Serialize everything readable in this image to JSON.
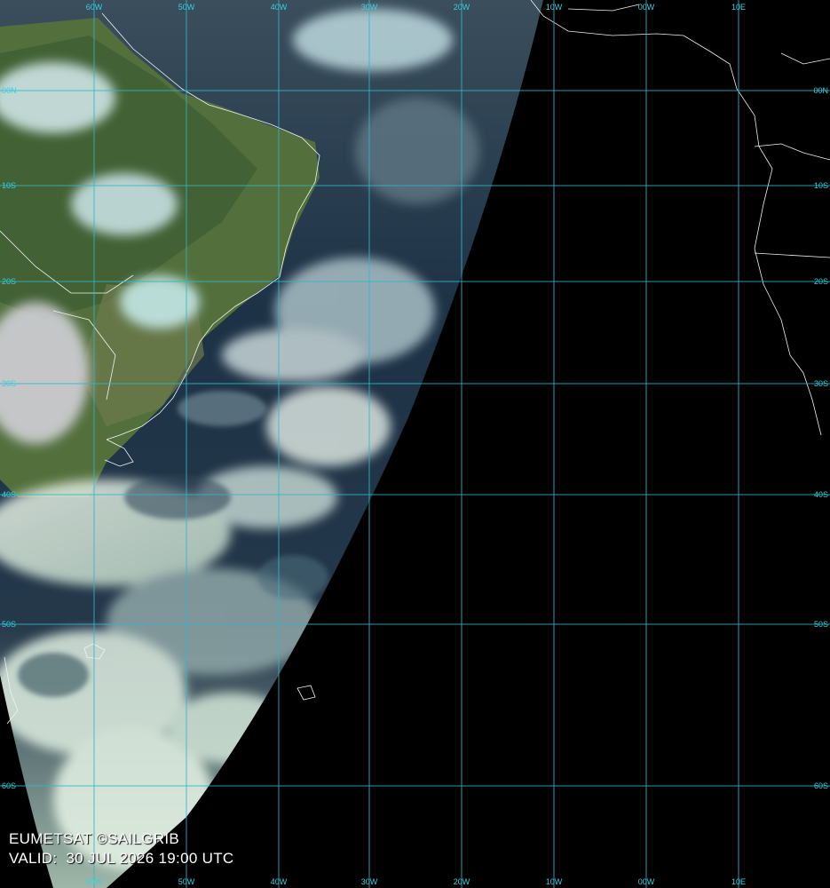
{
  "caption": {
    "source": "EUMETSAT ©SAILGRIB",
    "valid_label": "VALID:",
    "valid_time": "30 JUL 2026 19:00 UTC"
  },
  "grid": {
    "longitude_labels_top": [
      "60W",
      "50W",
      "40W",
      "30W",
      "20W",
      "10W",
      "00W",
      "10E"
    ],
    "longitude_labels_bottom": [
      "60W",
      "50W",
      "40W",
      "30W",
      "20W",
      "10W",
      "00W",
      "10E"
    ],
    "latitude_labels_left": [
      "00N",
      "10S",
      "20S",
      "30S",
      "40S",
      "50S",
      "60S"
    ],
    "latitude_labels_right": [
      "00N",
      "10S",
      "20S",
      "30S",
      "40S",
      "50S",
      "60S"
    ],
    "line_color": "#2fb8c8"
  },
  "colors": {
    "night_side": "#000000",
    "ocean": "#1f3448",
    "land": "#4f6b3a",
    "cloud": "#d8e6ea"
  }
}
